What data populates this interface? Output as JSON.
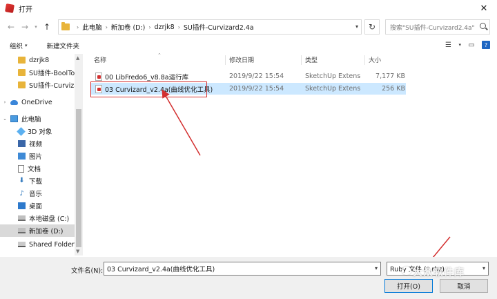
{
  "window": {
    "title": "打开"
  },
  "nav": {
    "breadcrumbs": [
      "此电脑",
      "新加卷 (D:)",
      "dzrjk8",
      "SU插件-Curvizard2.4a"
    ],
    "search_placeholder": "搜索\"SU插件-Curvizard2.4a\""
  },
  "toolbar": {
    "organize": "组织",
    "new_folder": "新建文件夹"
  },
  "sidebar": {
    "items": [
      {
        "label": "dzrjk8",
        "icon": "folder-icon"
      },
      {
        "label": "SU插件-BoolTo",
        "icon": "folder-icon"
      },
      {
        "label": "SU插件-Curviza",
        "icon": "folder-icon"
      },
      {
        "label": "OneDrive",
        "icon": "cloud-icon"
      },
      {
        "label": "此电脑",
        "icon": "computer-icon"
      },
      {
        "label": "3D 对象",
        "icon": "cube-icon"
      },
      {
        "label": "视频",
        "icon": "video-icon"
      },
      {
        "label": "图片",
        "icon": "picture-icon"
      },
      {
        "label": "文档",
        "icon": "document-icon"
      },
      {
        "label": "下载",
        "icon": "download-icon"
      },
      {
        "label": "音乐",
        "icon": "music-icon"
      },
      {
        "label": "桌面",
        "icon": "desktop-icon"
      },
      {
        "label": "本地磁盘 (C:)",
        "icon": "drive-icon"
      },
      {
        "label": "新加卷 (D:)",
        "icon": "drive-icon"
      },
      {
        "label": "Shared Folders",
        "icon": "shared-folder-icon"
      }
    ]
  },
  "filelist": {
    "columns": [
      "名称",
      "修改日期",
      "类型",
      "大小"
    ],
    "rows": [
      {
        "name": "00 LibFredo6_v8.8a运行库",
        "date": "2019/9/22 15:54",
        "type": "SketchUp Extens...",
        "size": "7,177 KB"
      },
      {
        "name": "03 Curvizard_v2.4a(曲线优化工具)",
        "date": "2019/9/22 15:54",
        "type": "SketchUp Extens...",
        "size": "256 KB"
      }
    ]
  },
  "footer": {
    "filename_label": "文件名(N):",
    "filename_value": "03 Curvizard_v2.4a(曲线优化工具)",
    "filetype_value": "Ruby 文件 (*.rbz)",
    "open_label": "打开(O)",
    "cancel_label": "取消"
  },
  "watermark": {
    "text": "大众软件库"
  },
  "colors": {
    "selection": "#cce8ff",
    "annotation_red": "#d32f2f",
    "accent": "#0078d7"
  }
}
